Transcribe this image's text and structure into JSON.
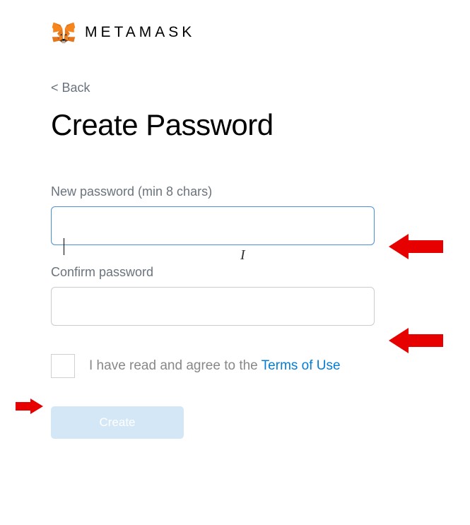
{
  "header": {
    "brand": "METAMASK"
  },
  "nav": {
    "back_label": "< Back"
  },
  "page": {
    "title": "Create Password"
  },
  "form": {
    "new_password_label": "New password (min 8 chars)",
    "new_password_value": "",
    "confirm_password_label": "Confirm password",
    "confirm_password_value": ""
  },
  "agreement": {
    "prefix_text": "I have read and agree to the ",
    "terms_link_text": "Terms of Use",
    "checked": false
  },
  "actions": {
    "create_label": "Create"
  },
  "annotations": {
    "arrow_color": "#e60000"
  }
}
